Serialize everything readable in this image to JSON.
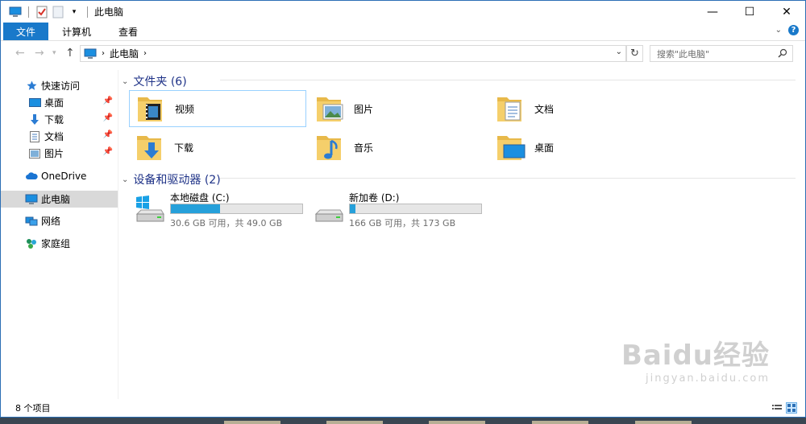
{
  "window": {
    "title": "此电脑",
    "min_glyph": "—",
    "max_glyph": "☐",
    "close_glyph": "✕"
  },
  "ribbon": {
    "tabs": [
      {
        "label": "文件"
      },
      {
        "label": "计算机"
      },
      {
        "label": "查看"
      }
    ]
  },
  "address": {
    "crumbs": [
      "此电脑"
    ],
    "search_placeholder": "搜索\"此电脑\""
  },
  "nav": {
    "quick_access": "快速访问",
    "quick_items": [
      {
        "label": "桌面",
        "icon": "desktop-icon"
      },
      {
        "label": "下载",
        "icon": "download-icon"
      },
      {
        "label": "文档",
        "icon": "document-icon"
      },
      {
        "label": "图片",
        "icon": "picture-icon"
      }
    ],
    "onedrive": "OneDrive",
    "this_pc": "此电脑",
    "network": "网络",
    "homegroup": "家庭组"
  },
  "folders_group": {
    "title": "文件夹 (6)",
    "items": [
      {
        "label": "视频",
        "icon": "video-folder-icon"
      },
      {
        "label": "图片",
        "icon": "picture-folder-icon"
      },
      {
        "label": "文档",
        "icon": "document-folder-icon"
      },
      {
        "label": "下载",
        "icon": "download-folder-icon"
      },
      {
        "label": "音乐",
        "icon": "music-folder-icon"
      },
      {
        "label": "桌面",
        "icon": "desktop-folder-icon"
      }
    ]
  },
  "drives_group": {
    "title": "设备和驱动器 (2)",
    "items": [
      {
        "name": "本地磁盘 (C:)",
        "usage": "30.6 GB 可用，共 49.0 GB",
        "used_fraction": 0.376
      },
      {
        "name": "新加卷 (D:)",
        "usage": "166 GB 可用，共 173 GB",
        "used_fraction": 0.04
      }
    ]
  },
  "status": {
    "count": "8 个项目"
  },
  "watermark": {
    "brand": "Baidu经验",
    "url": "jingyan.baidu.com"
  },
  "colors": {
    "accent": "#1979ca",
    "drive_bar": "#26a0da",
    "group_header": "#1e3287",
    "folder": "#f5cf6b"
  }
}
